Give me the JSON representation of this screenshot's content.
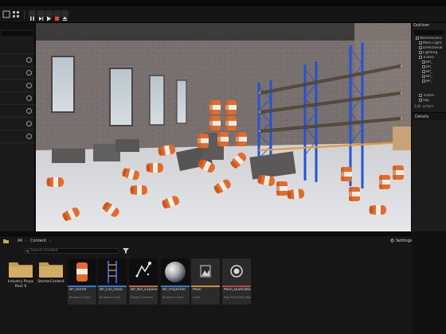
{
  "toolbar": {
    "play_icon": "pause-icon",
    "buttons": [
      "pause",
      "step",
      "play",
      "stop",
      "eject"
    ]
  },
  "outliner": {
    "title": "Outliner",
    "items": [
      {
        "label": "Warehouse1",
        "indent": 0
      },
      {
        "label": "Main Light",
        "indent": 1
      },
      {
        "label": "Directional",
        "indent": 1
      },
      {
        "label": "Lighting",
        "indent": 1
      },
      {
        "label": "Tracks",
        "indent": 1
      },
      {
        "label": "BP_",
        "indent": 2
      },
      {
        "label": "BP_",
        "indent": 2
      },
      {
        "label": "BP_",
        "indent": 2
      },
      {
        "label": "BP_",
        "indent": 2
      },
      {
        "label": "BP_",
        "indent": 2
      },
      {
        "label": "Tracks",
        "indent": 1
      },
      {
        "label": "Sky",
        "indent": 1
      }
    ],
    "count": "2,Br actors"
  },
  "details": {
    "title": "Details"
  },
  "content_browser": {
    "path": [
      "All",
      "Content"
    ],
    "settings_label": "Settings",
    "search_placeholder": "Search Content",
    "folders": [
      {
        "name": "Industry Props Pack 6"
      },
      {
        "name": "StarterContent"
      }
    ],
    "assets": [
      {
        "name": "BP_Barrel",
        "type": "Blueprint Class",
        "stripe": "#2b7bd6"
      },
      {
        "name": "BP_Full_Rack",
        "type": "Blueprint Class",
        "stripe": "#2b7bd6"
      },
      {
        "name": "BP_Niz_Explosion",
        "type": "Niagara System",
        "stripe": "#c8643a"
      },
      {
        "name": "BP_Projectile",
        "type": "Blueprint Class",
        "stripe": "#2b7bd6"
      },
      {
        "name": "Main",
        "type": "Level",
        "stripe": "#d38a33"
      },
      {
        "name": "Main_BuiltData",
        "type": "Map Build Data Registry",
        "stripe": "#c34040"
      }
    ]
  }
}
